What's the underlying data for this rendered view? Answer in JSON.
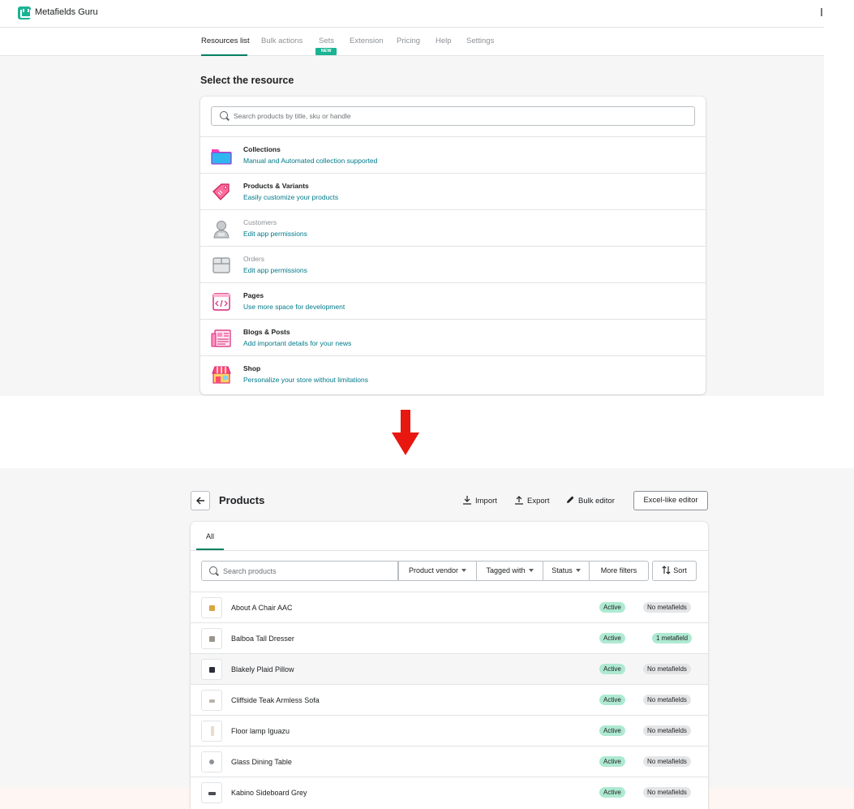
{
  "top": {
    "app_title": "Metafields Guru",
    "nav_tabs": [
      {
        "label": "Resources list",
        "active": true
      },
      {
        "label": "Bulk actions",
        "active": false
      },
      {
        "label": "Sets",
        "active": false,
        "badge": "NEW"
      },
      {
        "label": "Extension",
        "active": false
      },
      {
        "label": "Pricing",
        "active": false
      },
      {
        "label": "Help",
        "active": false
      },
      {
        "label": "Settings",
        "active": false
      }
    ],
    "section_title": "Select the resource",
    "search_placeholder": "Search products by title, sku or handle",
    "resources": [
      {
        "title": "Collections",
        "subtitle": "Manual and Automated collection supported",
        "icon": "folder-icon",
        "enabled": true
      },
      {
        "title": "Products & Variants",
        "subtitle": "Easily customize your products",
        "icon": "price-tag-icon",
        "enabled": true
      },
      {
        "title": "Customers",
        "subtitle": "Edit app permissions",
        "icon": "customer-icon",
        "enabled": false
      },
      {
        "title": "Orders",
        "subtitle": "Edit app permissions",
        "icon": "box-icon",
        "enabled": false
      },
      {
        "title": "Pages",
        "subtitle": "Use more space for development",
        "icon": "code-page-icon",
        "enabled": true
      },
      {
        "title": "Blogs & Posts",
        "subtitle": "Add important details for your news",
        "icon": "newspaper-icon",
        "enabled": true
      },
      {
        "title": "Shop",
        "subtitle": "Personalize your store without limitations",
        "icon": "storefront-icon",
        "enabled": true
      }
    ]
  },
  "bottom": {
    "page_title": "Products",
    "actions": {
      "import": "Import",
      "export": "Export",
      "bulk_editor": "Bulk editor",
      "excel_editor": "Excel-like editor"
    },
    "tab_all": "All",
    "search_placeholder": "Search products",
    "filters": {
      "vendor": "Product vendor",
      "tagged": "Tagged with",
      "status": "Status",
      "more": "More filters",
      "sort": "Sort"
    },
    "products": [
      {
        "name": "About A Chair AAC",
        "status": "Active",
        "metafields": "No metafields"
      },
      {
        "name": "Balboa Tall Dresser",
        "status": "Active",
        "metafields": "1 metafield"
      },
      {
        "name": "Blakely Plaid Pillow",
        "status": "Active",
        "metafields": "No metafields"
      },
      {
        "name": "Cliffside Teak Armless Sofa",
        "status": "Active",
        "metafields": "No metafields"
      },
      {
        "name": "Floor lamp Iguazu",
        "status": "Active",
        "metafields": "No metafields"
      },
      {
        "name": "Glass Dining Table",
        "status": "Active",
        "metafields": "No metafields"
      },
      {
        "name": "Kabino Sideboard Grey",
        "status": "Active",
        "metafields": "No metafields"
      }
    ]
  },
  "colors": {
    "accent_green": "#008060",
    "brand_teal": "#1ab394",
    "link_teal": "#007a8a",
    "badge_green": "#aee9d1",
    "badge_grey": "#e4e5e7",
    "arrow_red": "#e8170f"
  }
}
